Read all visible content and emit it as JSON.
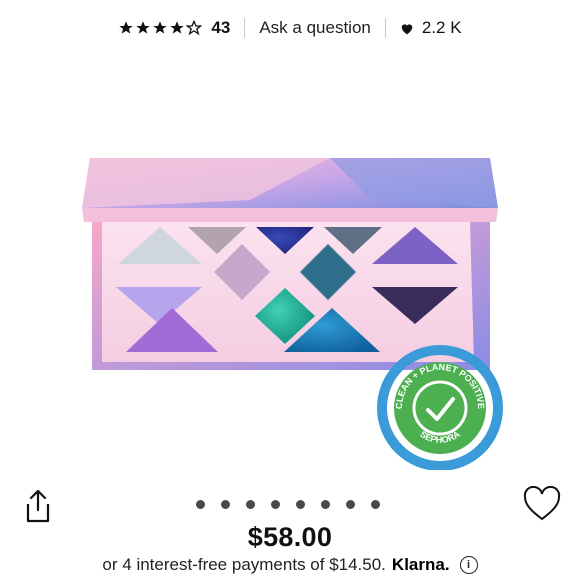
{
  "rating": {
    "value": 4.5,
    "stars_total": 5,
    "count": "43"
  },
  "ask_label": "Ask a question",
  "loves_count": "2.2 K",
  "badge": {
    "top": "CLEAN + PLANET POSITIVE",
    "bottom": "SEPHORA"
  },
  "carousel": {
    "slide_count": 8,
    "active_index": 0
  },
  "price": "$58.00",
  "installments": {
    "text": "or 4 interest-free payments of $14.50.",
    "provider": "Klarna.",
    "info_glyph": "i"
  },
  "icons": {
    "share": "share-icon",
    "wishlist": "heart-outline-icon",
    "loves": "heart-filled-icon",
    "info": "info-icon"
  },
  "colors": {
    "badge_green": "#4caf50",
    "badge_blue": "#3b9bd8",
    "palette_pink": "#f7d3e6"
  }
}
